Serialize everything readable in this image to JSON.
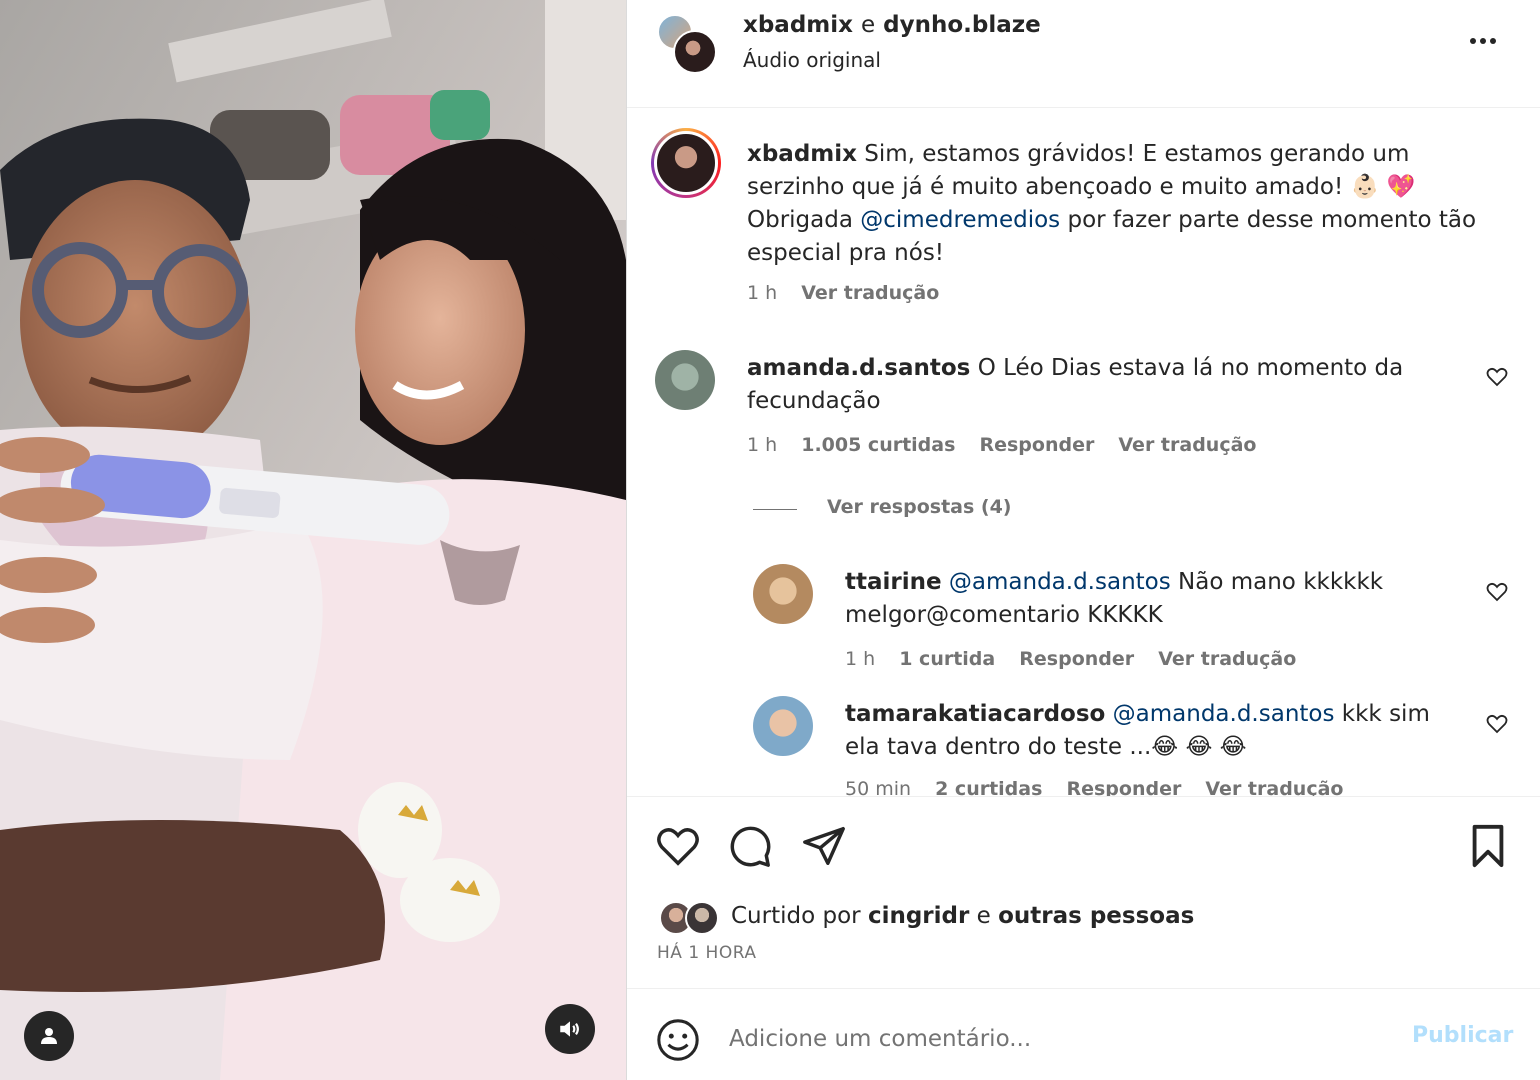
{
  "header": {
    "user1": "xbadmix",
    "conj": "e",
    "user2": "dynho.blaze",
    "audio": "Áudio original"
  },
  "caption": {
    "username": "xbadmix",
    "line1": "Sim, estamos grávidos! E estamos gerando um serzinho que já é muito abençoado e muito amado! 👶🏻 💖",
    "thanks_prefix": "Obrigada",
    "mention": "@cimedremedios",
    "thanks_suffix": "por fazer parte desse momento tão especial pra nós!",
    "time": "1 h",
    "translate": "Ver tradução"
  },
  "comments": [
    {
      "username": "amanda.d.santos",
      "text": "O Léo Dias estava lá no momento da fecundação",
      "time": "1 h",
      "likes": "1.005 curtidas",
      "reply": "Responder",
      "translate": "Ver tradução",
      "view_replies": "Ver respostas (4)"
    }
  ],
  "replies": [
    {
      "username": "ttairine",
      "mention": "@amanda.d.santos",
      "text": "Não mano kkkkkk melgor@comentario KKKKK",
      "time": "1 h",
      "likes": "1 curtida",
      "reply": "Responder",
      "translate": "Ver tradução"
    },
    {
      "username": "tamarakatiacardoso",
      "mention": "@amanda.d.santos",
      "text": "kkk sim ela tava dentro do teste ...😂 😂 😂",
      "time": "50 min",
      "likes": "2 curtidas",
      "reply": "Responder",
      "translate": "Ver tradução"
    }
  ],
  "likes": {
    "prefix": "Curtido por",
    "user": "cingridr",
    "conj": "e",
    "others": "outras pessoas",
    "time_ago": "HÁ 1 HORA"
  },
  "composer": {
    "placeholder": "Adicione um comentário...",
    "publish": "Publicar"
  },
  "icons": {
    "like": "heart-icon",
    "comment": "comment-icon",
    "share": "share-icon",
    "save": "bookmark-icon",
    "emoji": "emoji-icon",
    "more": "more-icon",
    "user": "user-icon",
    "volume": "volume-icon"
  },
  "colors": {
    "text": "#262626",
    "secondary": "#737373",
    "link": "#00376b",
    "publish_disabled": "#b2dffc"
  }
}
